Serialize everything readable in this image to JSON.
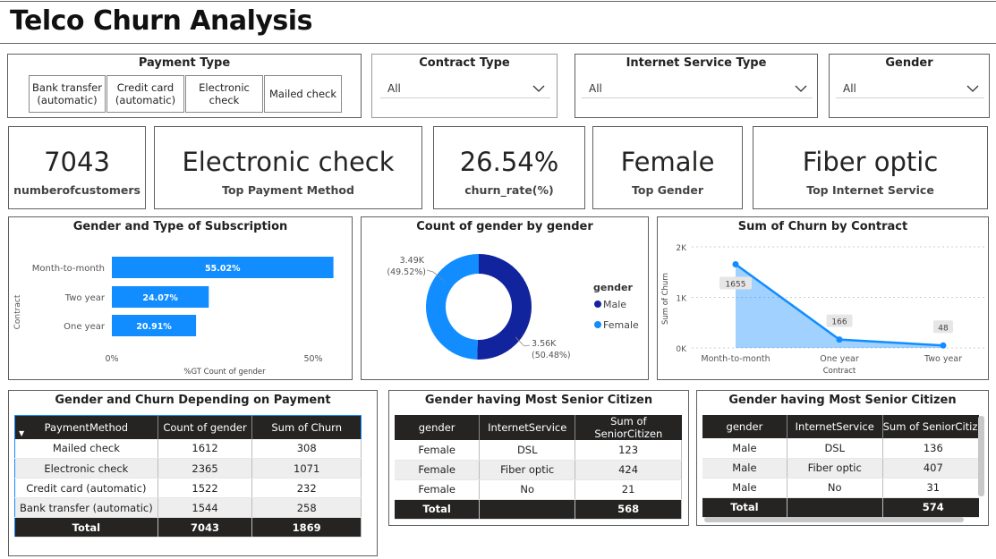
{
  "title": "Telco Churn Analysis",
  "payment": {
    "title": "Payment Type",
    "options": [
      "Bank transfer (automatic)",
      "Credit card (automatic)",
      "Electronic check",
      "Mailed check"
    ]
  },
  "contract": {
    "title": "Contract Type",
    "value": "All"
  },
  "internet": {
    "title": "Internet Service Type",
    "value": "All"
  },
  "gender": {
    "title": "Gender",
    "value": "All"
  },
  "kpis": [
    {
      "value": "7043",
      "label": "numberofcustomers"
    },
    {
      "value": "Electronic check",
      "label": "Top Payment Method"
    },
    {
      "value": "26.54%",
      "label": "churn_rate(%)"
    },
    {
      "value": "Female",
      "label": "Top Gender"
    },
    {
      "value": "Fiber optic",
      "label": "Top Internet Service"
    }
  ],
  "chart_data": [
    {
      "type": "bar",
      "title": "Gender and Type of Subscription",
      "ylabel": "Contract",
      "xlabel": "%GT Count of gender",
      "categories": [
        "Month-to-month",
        "Two year",
        "One year"
      ],
      "values": [
        55.02,
        24.07,
        20.91
      ],
      "value_labels": [
        "55.02%",
        "24.07%",
        "20.91%"
      ],
      "xticks": [
        "0%",
        "50%"
      ],
      "xlim": [
        0,
        60
      ],
      "color": "#118dff"
    },
    {
      "type": "pie",
      "title": "Count of gender by gender",
      "legend_title": "gender",
      "slices": [
        {
          "name": "Male",
          "value": 3.56,
          "label": "3.56K",
          "pct": "(50.48%)",
          "color": "#12239e"
        },
        {
          "name": "Female",
          "value": 3.49,
          "label": "3.49K",
          "pct": "(49.52%)",
          "color": "#118dff"
        }
      ]
    },
    {
      "type": "area",
      "title": "Sum of Churn by Contract",
      "xlabel": "Contract",
      "ylabel": "Sum of Churn",
      "categories": [
        "Month-to-month",
        "One year",
        "Two year"
      ],
      "values": [
        1655,
        166,
        48
      ],
      "value_labels": [
        "1655",
        "166",
        "48"
      ],
      "yticks": [
        "0K",
        "1K",
        "2K"
      ],
      "ylim": [
        0,
        2000
      ],
      "color": "#118dff"
    }
  ],
  "table1": {
    "title": "Gender and Churn Depending on Payment",
    "headers": [
      "PaymentMethod",
      "Count of gender",
      "Sum of Churn"
    ],
    "rows": [
      [
        "Mailed check",
        "1612",
        "308"
      ],
      [
        "Electronic check",
        "2365",
        "1071"
      ],
      [
        "Credit card (automatic)",
        "1522",
        "232"
      ],
      [
        "Bank transfer (automatic)",
        "1544",
        "258"
      ]
    ],
    "total": [
      "Total",
      "7043",
      "1869"
    ]
  },
  "table2": {
    "title": "Gender having Most Senior Citizen",
    "headers": [
      "gender",
      "InternetService",
      "Sum of SeniorCitizen"
    ],
    "rows": [
      [
        "Female",
        "DSL",
        "123"
      ],
      [
        "Female",
        "Fiber optic",
        "424"
      ],
      [
        "Female",
        "No",
        "21"
      ]
    ],
    "total": [
      "Total",
      "",
      "568"
    ]
  },
  "table3": {
    "title": "Gender having Most Senior Citizen",
    "headers": [
      "gender",
      "InternetService",
      "Sum of SeniorCitize"
    ],
    "rows": [
      [
        "Male",
        "DSL",
        "136"
      ],
      [
        "Male",
        "Fiber optic",
        "407"
      ],
      [
        "Male",
        "No",
        "31"
      ]
    ],
    "total": [
      "Total",
      "",
      "574"
    ]
  }
}
